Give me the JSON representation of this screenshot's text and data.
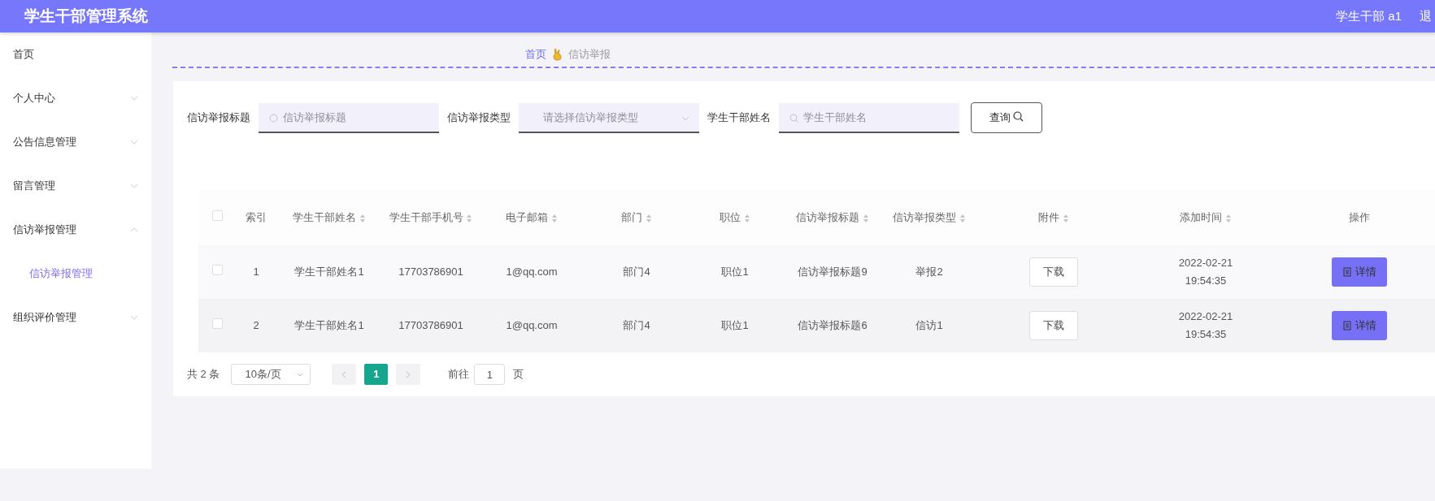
{
  "header": {
    "title": "学生干部管理系统",
    "user": "学生干部 a1",
    "logout": "退"
  },
  "sidebar": {
    "items": [
      {
        "label": "首页"
      },
      {
        "label": "个人中心",
        "expandable": true,
        "expanded": false
      },
      {
        "label": "公告信息管理",
        "expandable": true,
        "expanded": false
      },
      {
        "label": "留言管理",
        "expandable": true,
        "expanded": false
      },
      {
        "label": "信访举报管理",
        "expandable": true,
        "expanded": true,
        "children": [
          {
            "label": "信访举报管理",
            "selected": true
          }
        ]
      },
      {
        "label": "组织评价管理",
        "expandable": true,
        "expanded": false
      }
    ]
  },
  "breadcrumb": [
    {
      "label": "首页",
      "selected": true
    },
    {
      "label": "信访举报",
      "selected": false
    }
  ],
  "search": {
    "fields": [
      {
        "label": "信访举报标题",
        "kind": "text",
        "placeholder": "信访举报标题"
      },
      {
        "label": "信访举报类型",
        "kind": "select",
        "placeholder": "请选择信访举报类型"
      },
      {
        "label": "学生干部姓名",
        "kind": "text",
        "placeholder": "学生干部姓名"
      }
    ],
    "button": "查询"
  },
  "table": {
    "header_checked": false,
    "columns": [
      {
        "label": "索引",
        "sortable": false
      },
      {
        "label": "学生干部姓名",
        "sortable": true
      },
      {
        "label": "学生干部手机号",
        "sortable": true
      },
      {
        "label": "电子邮箱",
        "sortable": true
      },
      {
        "label": "部门",
        "sortable": true
      },
      {
        "label": "职位",
        "sortable": true
      },
      {
        "label": "信访举报标题",
        "sortable": true
      },
      {
        "label": "信访举报类型",
        "sortable": true
      },
      {
        "label": "附件",
        "sortable": true
      },
      {
        "label": "添加时间",
        "sortable": true
      },
      {
        "label": "操作",
        "sortable": false
      }
    ],
    "rows": [
      {
        "selected": false,
        "cells": [
          "1",
          "学生干部姓名1",
          "17703786901",
          "1@qq.com",
          "部门4",
          "职位1",
          "信访举报标题9",
          "举报2"
        ],
        "attachment": "下载",
        "time": "2022-02-21 19:54:35",
        "action": "详情"
      },
      {
        "selected": false,
        "cells": [
          "2",
          "学生干部姓名1",
          "17703786901",
          "1@qq.com",
          "部门4",
          "职位1",
          "信访举报标题6",
          "信访1"
        ],
        "attachment": "下载",
        "time": "2022-02-21 19:54:35",
        "action": "详情"
      }
    ]
  },
  "pagination": {
    "total": "共 2 条",
    "page_size": "10条/页",
    "pages": [
      {
        "label": "1",
        "selected": true
      }
    ],
    "goto_label": "前往",
    "goto_value": "1",
    "goto_suffix": "页"
  }
}
